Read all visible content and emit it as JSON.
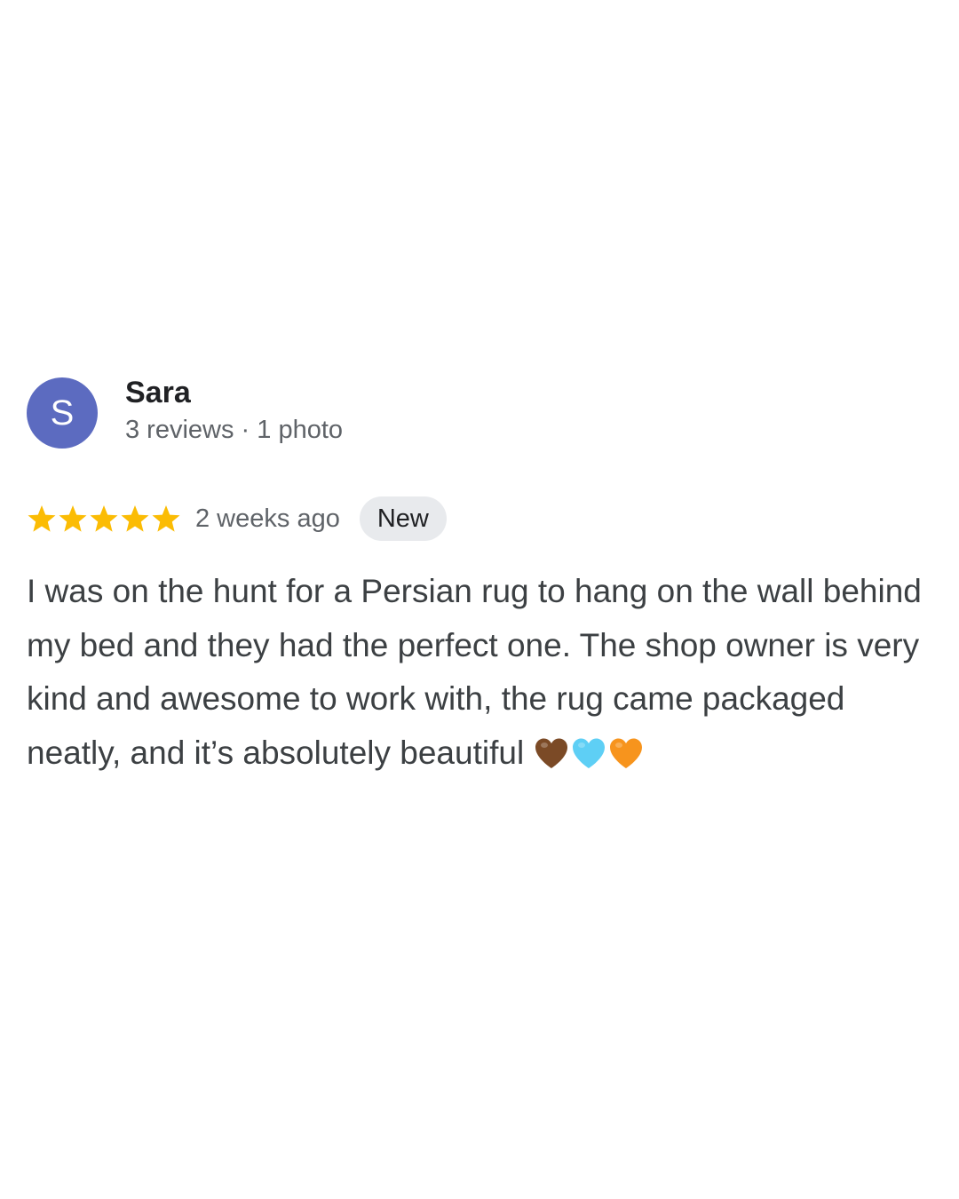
{
  "reviewer": {
    "initial": "S",
    "name": "Sara",
    "meta": "3 reviews · 1 photo",
    "avatar_color": "#5c6bc0"
  },
  "rating": {
    "stars": 5,
    "max": 5,
    "star_color": "#fbbc04"
  },
  "review": {
    "date": "2 weeks ago",
    "badge": "New",
    "text": "I was on the hunt for a Persian rug to hang on the wall behind my bed and they had the perfect one. The shop owner is very kind and awesome to work with, the rug came packaged neatly, and it’s absolutely beautiful",
    "emojis": [
      {
        "icon": "brown-heart-icon",
        "color": "#7b4a26"
      },
      {
        "icon": "light-blue-heart-icon",
        "color": "#5ecff5"
      },
      {
        "icon": "orange-heart-icon",
        "color": "#f7941d"
      }
    ]
  }
}
